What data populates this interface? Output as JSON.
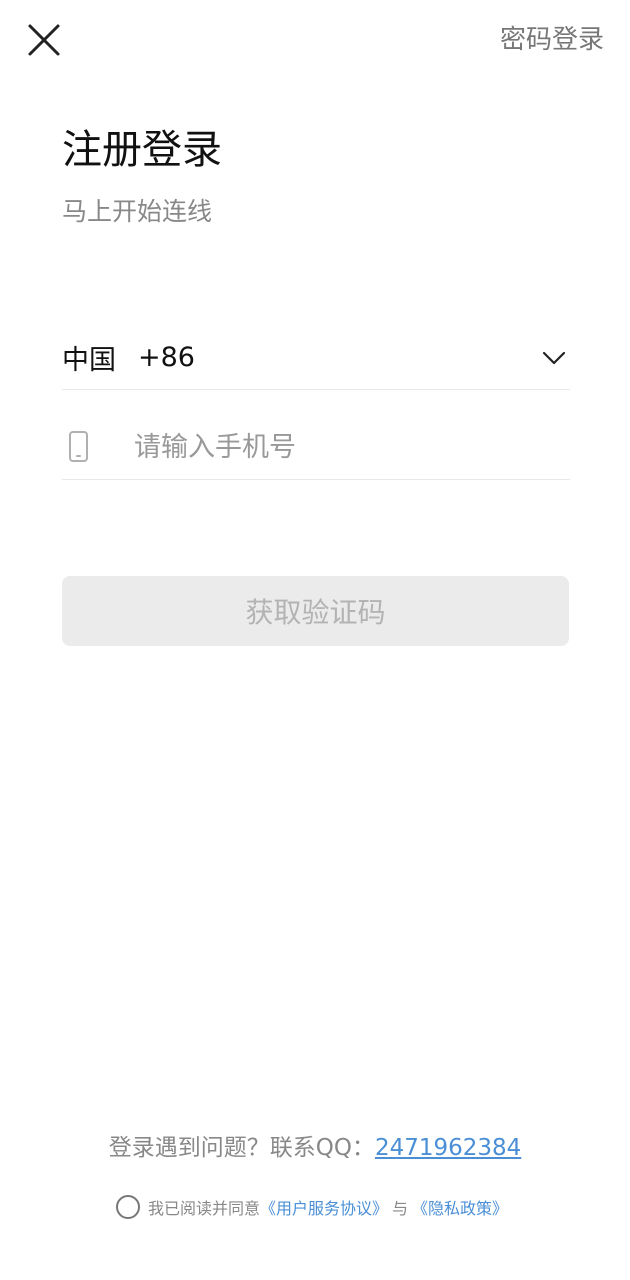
{
  "header": {
    "close_icon": "close-icon",
    "password_login_label": "密码登录"
  },
  "main": {
    "title": "注册登录",
    "subtitle": "马上开始连线",
    "country": {
      "name": "中国",
      "code": "+86",
      "dropdown_icon": "chevron-down-icon"
    },
    "phone": {
      "icon": "phone-icon",
      "value": "",
      "placeholder": "请输入手机号"
    },
    "get_code_label": "获取验证码"
  },
  "footer": {
    "help_prefix": "登录遇到问题？联系QQ：",
    "help_qq": "2471962384",
    "agree_prefix": "我已阅读并同意",
    "user_agreement": "《用户服务协议》",
    "and_text": "与",
    "privacy_policy": "《隐私政策》"
  },
  "colors": {
    "accent_link": "#4a8fd6",
    "button_disabled_bg": "#ebebeb",
    "button_disabled_text": "#b3b3b3"
  }
}
